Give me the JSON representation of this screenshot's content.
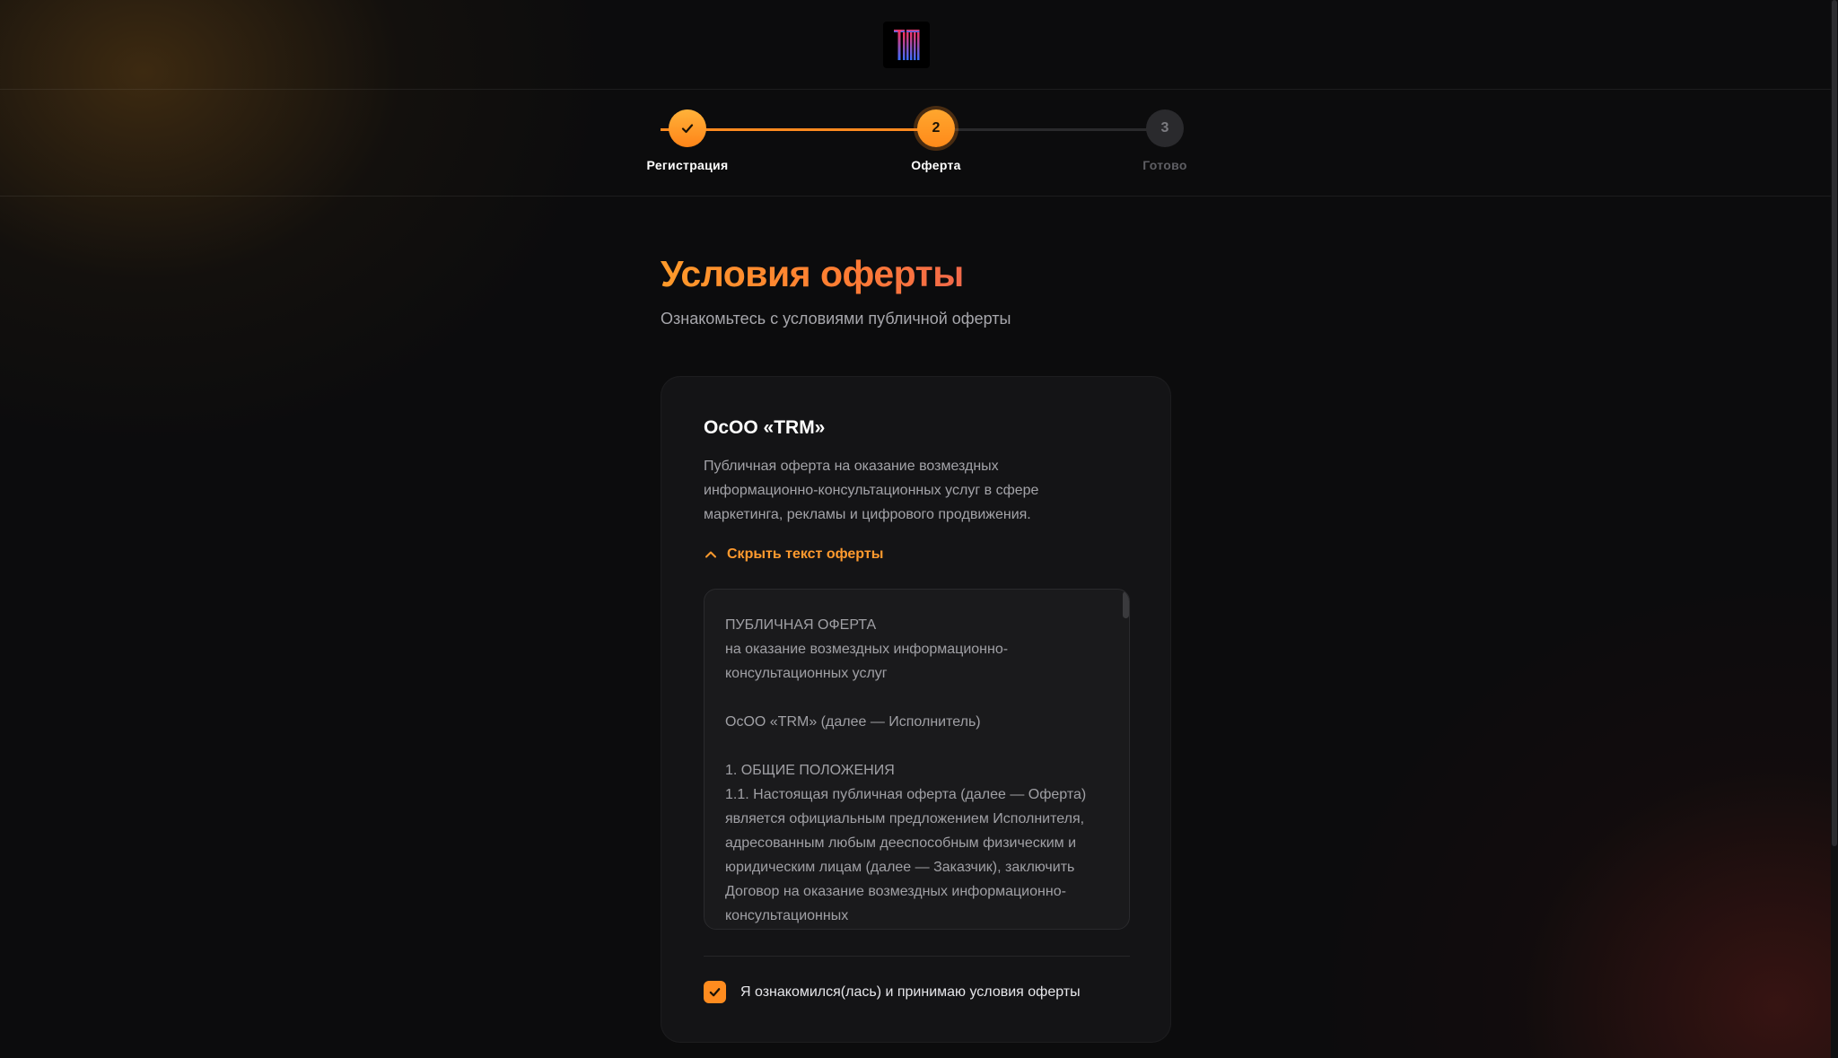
{
  "brand": {
    "logo_text": "TRM",
    "accent": "#ff8a1f"
  },
  "stepper": {
    "steps": [
      {
        "number": "1",
        "label": "Регистрация",
        "state": "completed"
      },
      {
        "number": "2",
        "label": "Оферта",
        "state": "active"
      },
      {
        "number": "3",
        "label": "Готово",
        "state": "pending"
      }
    ]
  },
  "page": {
    "title": "Условия оферты",
    "subtitle": "Ознакомьтесь с условиями публичной оферты"
  },
  "card": {
    "company": "ОсОО «TRM»",
    "description": "Публичная оферта на оказание возмездных информационно-консультационных услуг в сфере маркетинга, рекламы и цифрового продвижения.",
    "toggle_label": "Скрыть текст оферты",
    "offer_text": "ПУБЛИЧНАЯ ОФЕРТА\nна оказание возмездных информационно-\nконсультационных услуг\n\nОсОО «TRM» (далее — Исполнитель)\n\n1. ОБЩИЕ ПОЛОЖЕНИЯ\n1.1. Настоящая публичная оферта (далее — Оферта) является официальным предложением Исполнителя, адресованным любым дееспособным физическим и юридическим лицам (далее — Заказчик), заключить Договор на оказание возмездных информационно-консультационных",
    "agree_label": "Я ознакомился(лась) и принимаю условия оферты",
    "agree_checked": true
  },
  "icons": {
    "step_done": "checkmark-icon",
    "toggle": "chevron-up-icon",
    "checkbox": "checkmark-icon"
  }
}
